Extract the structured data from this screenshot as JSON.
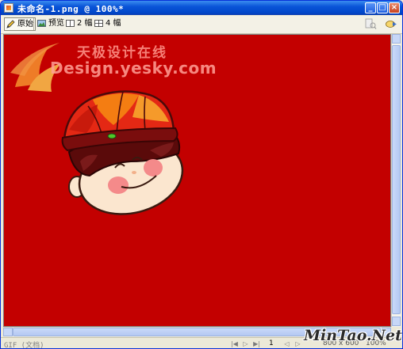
{
  "window": {
    "title": "未命名-1.png @ 100%*",
    "controls": {
      "minimize": "_",
      "maximize": "□",
      "close": "×"
    }
  },
  "toolbar": {
    "buttons": [
      {
        "label": "原始",
        "icon": "pencil-icon",
        "active": true
      },
      {
        "label": "预览",
        "icon": "preview-icon",
        "active": false
      },
      {
        "label": "2 幅",
        "icon": "two-up-icon",
        "active": false
      },
      {
        "label": "4 幅",
        "icon": "four-up-icon",
        "active": false
      }
    ],
    "right_icons": [
      "page-preview-icon",
      "quick-export-icon"
    ]
  },
  "watermarks": {
    "cn": "天极设计在线",
    "en": "Design.yesky.com",
    "corner": "MinTao.Net"
  },
  "statusbar": {
    "format": "GIF (文档)",
    "frame": "1",
    "size": "800 x 600",
    "zoom": "100%"
  },
  "colors": {
    "canvas_bg": "#c30000",
    "titlebar": "#0a55d8",
    "hat_red": "#e42814",
    "hat_orange": "#f47d12",
    "hair": "#5a0a0a",
    "skin": "#fbe6cf",
    "cheek": "#f48a8a"
  }
}
